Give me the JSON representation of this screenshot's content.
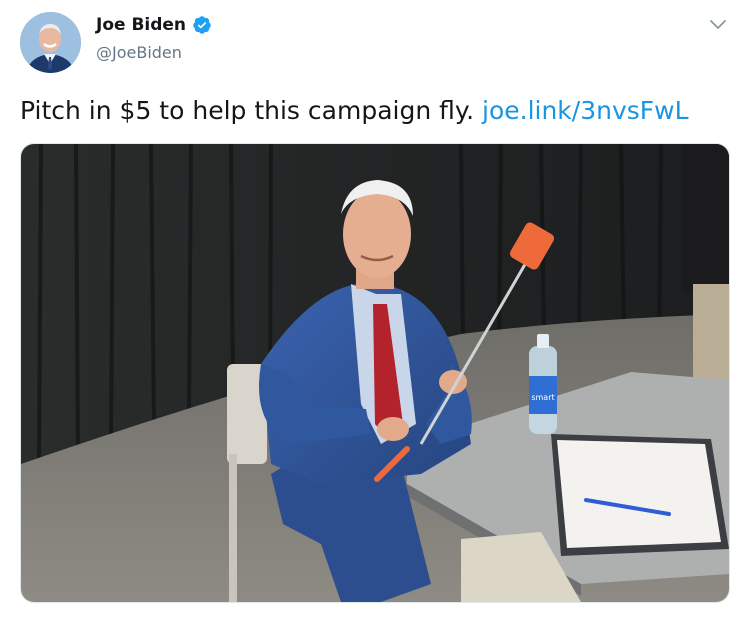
{
  "author": {
    "display_name": "Joe Biden",
    "handle": "@JoeBiden",
    "verified": true,
    "verified_icon": "verified-badge-icon",
    "avatar_icon": "profile-avatar"
  },
  "tweet": {
    "text": "Pitch in $5 to help this campaign fly.",
    "link_text": "joe.link/3nvsFwL",
    "menu_icon": "chevron-down-icon"
  },
  "media": {
    "kind": "photo",
    "bottle_label": "smart"
  },
  "colors": {
    "link": "#1b95e0",
    "verified": "#1da1f2",
    "handle": "#657786",
    "text": "#14171a"
  }
}
